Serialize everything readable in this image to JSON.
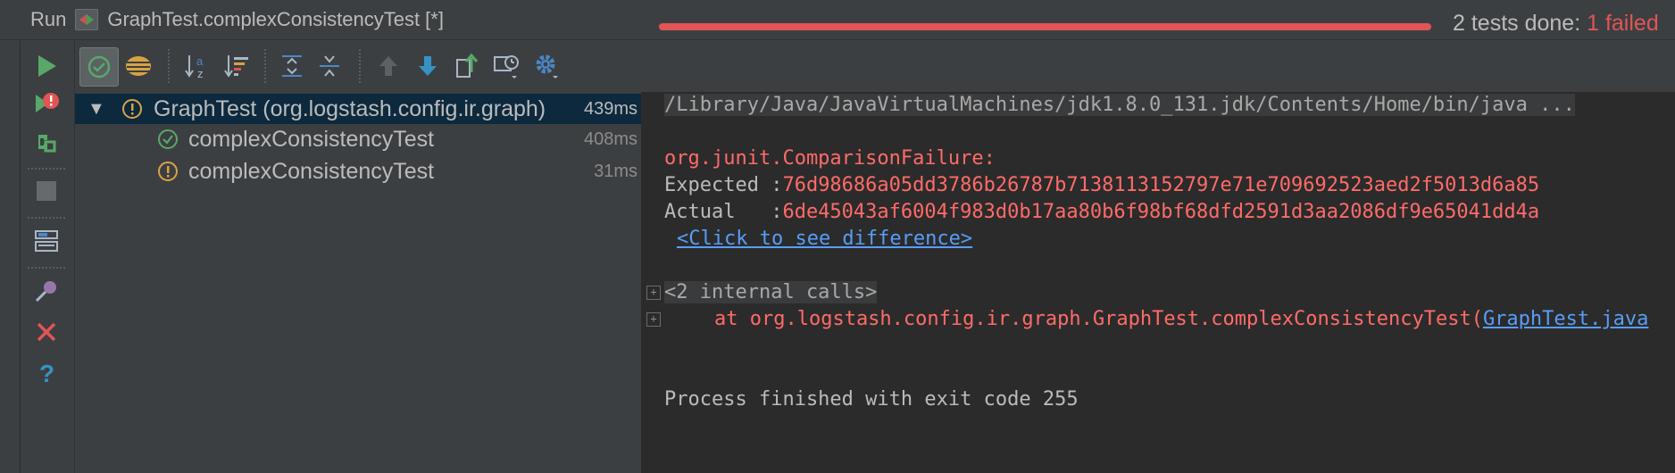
{
  "titlebar": {
    "run_label": "Run",
    "config_title": "GraphTest.complexConsistencyTest [*]"
  },
  "toolbar": {
    "buttons": [
      "show-passed",
      "show-ignored",
      "sort-alphabetically",
      "sort-by-duration",
      "expand-all",
      "collapse-all",
      "previous-failed",
      "next-failed",
      "export-results",
      "test-history",
      "settings"
    ],
    "status_prefix": "2 tests done: ",
    "status_failed": "1 failed",
    "progress": 1.0,
    "accent_fail": "#e05555",
    "accent_pass": "#499c54"
  },
  "tree": {
    "rows": [
      {
        "name": "GraphTest (org.logstash.config.ir.graph)",
        "time": "439ms",
        "status": "warning"
      },
      {
        "name": "complexConsistencyTest",
        "time": "408ms",
        "status": "passed"
      },
      {
        "name": "complexConsistencyTest",
        "time": "31ms",
        "status": "warning"
      }
    ]
  },
  "console": {
    "command": "/Library/Java/JavaVirtualMachines/jdk1.8.0_131.jdk/Contents/Home/bin/java ...",
    "failure_class": "org.junit.ComparisonFailure:",
    "expected_label": "Expected :",
    "expected_value": "76d98686a05dd3786b26787b7138113152797e71e709692523aed2f5013d6a85",
    "actual_label": "Actual   :",
    "actual_value": "6de45043af6004f983d0b17aa80b6f98bf68dfd2591d3aa2086df9e65041dd4a",
    "diff_link": "<Click to see difference>",
    "internal_calls": "<2 internal calls>",
    "stack_at": "at org.logstash.config.ir.graph.GraphTest.complexConsistencyTest(",
    "stack_link": "GraphTest.java",
    "exit_message": "Process finished with exit code 255"
  }
}
